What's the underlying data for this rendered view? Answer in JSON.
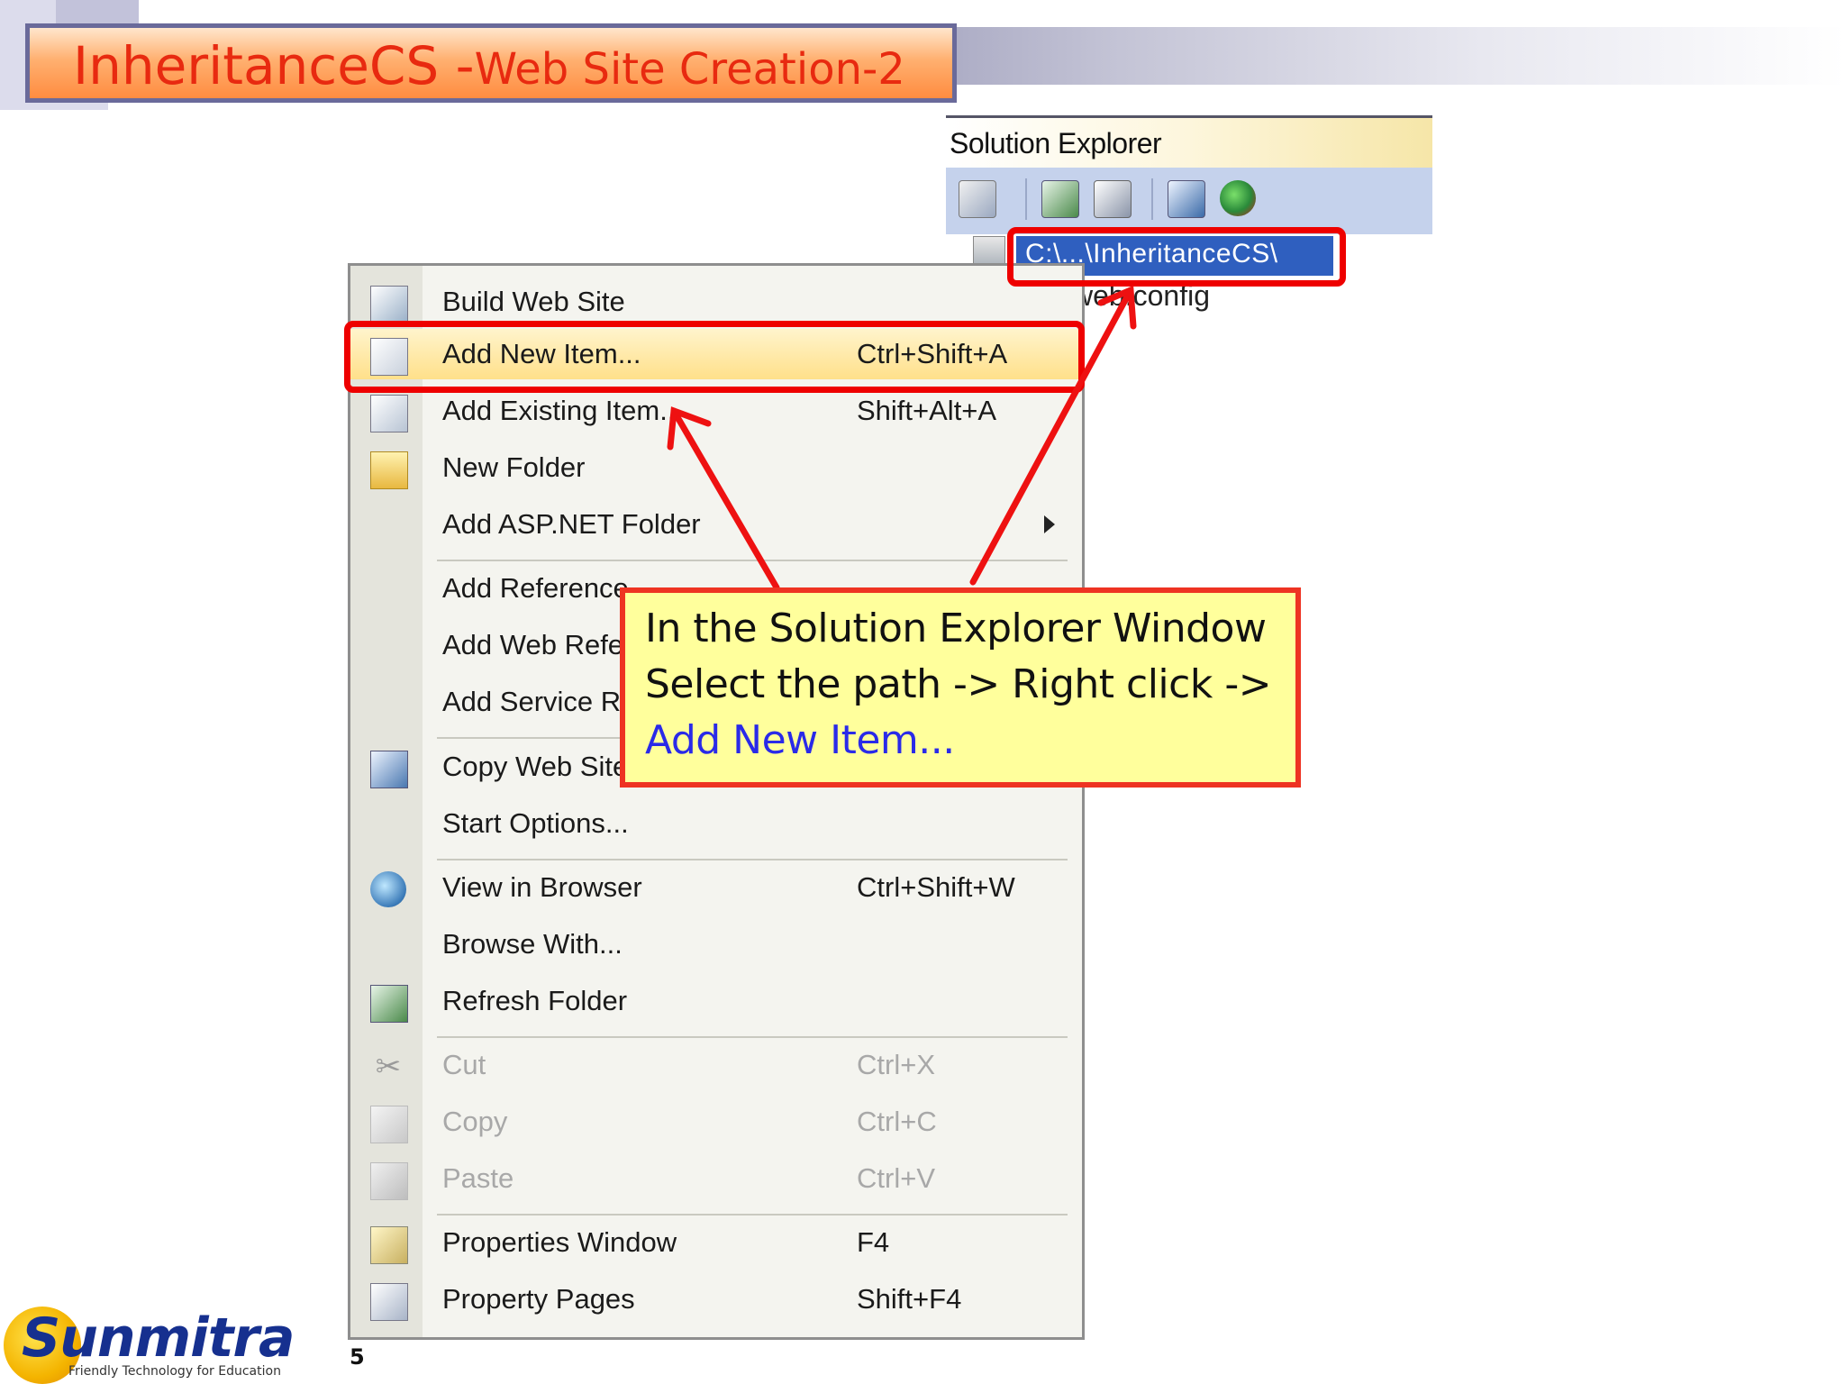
{
  "slide": {
    "title_main": "InheritanceCS -",
    "title_sub": "Web Site Creation-2",
    "page_number": "5"
  },
  "solution_explorer": {
    "title": "Solution Explorer",
    "toolbar_icons": [
      "properties-icon",
      "refresh-icon",
      "nest-files-icon",
      "copy-website-icon",
      "asp-config-icon"
    ],
    "selected_path": "C:\\...\\InheritanceCS\\",
    "tree_item": "web.config"
  },
  "context_menu": {
    "items": [
      {
        "label": "Build Web Site",
        "shortcut": "",
        "icon": "build-icon",
        "disabled": false
      },
      {
        "label": "Add New Item...",
        "shortcut": "Ctrl+Shift+A",
        "icon": "add-new-item-icon",
        "disabled": false
      },
      {
        "label": "Add Existing Item...",
        "shortcut": "Shift+Alt+A",
        "icon": "add-existing-item-icon",
        "disabled": false
      },
      {
        "label": "New Folder",
        "shortcut": "",
        "icon": "folder-icon",
        "disabled": false
      },
      {
        "label": "Add ASP.NET Folder",
        "shortcut": "",
        "icon": "",
        "disabled": false
      },
      {
        "label": "Add Reference...",
        "shortcut": "",
        "icon": "",
        "disabled": false
      },
      {
        "label": "Add Web Reference...",
        "shortcut": "",
        "icon": "",
        "disabled": false
      },
      {
        "label": "Add Service Reference...",
        "shortcut": "",
        "icon": "",
        "disabled": false
      },
      {
        "label": "Copy Web Site...",
        "shortcut": "",
        "icon": "copy-website-icon",
        "disabled": false
      },
      {
        "label": "Start Options...",
        "shortcut": "",
        "icon": "",
        "disabled": false
      },
      {
        "label": "View in Browser",
        "shortcut": "Ctrl+Shift+W",
        "icon": "view-in-browser-icon",
        "disabled": false
      },
      {
        "label": "Browse With...",
        "shortcut": "",
        "icon": "",
        "disabled": false
      },
      {
        "label": "Refresh Folder",
        "shortcut": "",
        "icon": "refresh-icon",
        "disabled": false
      },
      {
        "label": "Cut",
        "shortcut": "Ctrl+X",
        "icon": "cut-icon",
        "disabled": true
      },
      {
        "label": "Copy",
        "shortcut": "Ctrl+C",
        "icon": "copy-icon",
        "disabled": true
      },
      {
        "label": "Paste",
        "shortcut": "Ctrl+V",
        "icon": "paste-icon",
        "disabled": true
      },
      {
        "label": "Properties Window",
        "shortcut": "F4",
        "icon": "properties-window-icon",
        "disabled": false
      },
      {
        "label": "Property Pages",
        "shortcut": "Shift+F4",
        "icon": "property-pages-icon",
        "disabled": false
      }
    ]
  },
  "callout": {
    "line1": "In the Solution Explorer Window",
    "line2": "Select the path -> Right click ->",
    "line3": "Add New Item..."
  },
  "logo": {
    "name": "Sunmitra",
    "tagline": "Friendly Technology for Education"
  },
  "colors": {
    "annotation_red": "#ee0000",
    "title_text": "#e82a10",
    "callout_fill": "#ffff9c",
    "callout_link": "#2a2ae8",
    "selection_blue": "#2f5fbf"
  }
}
